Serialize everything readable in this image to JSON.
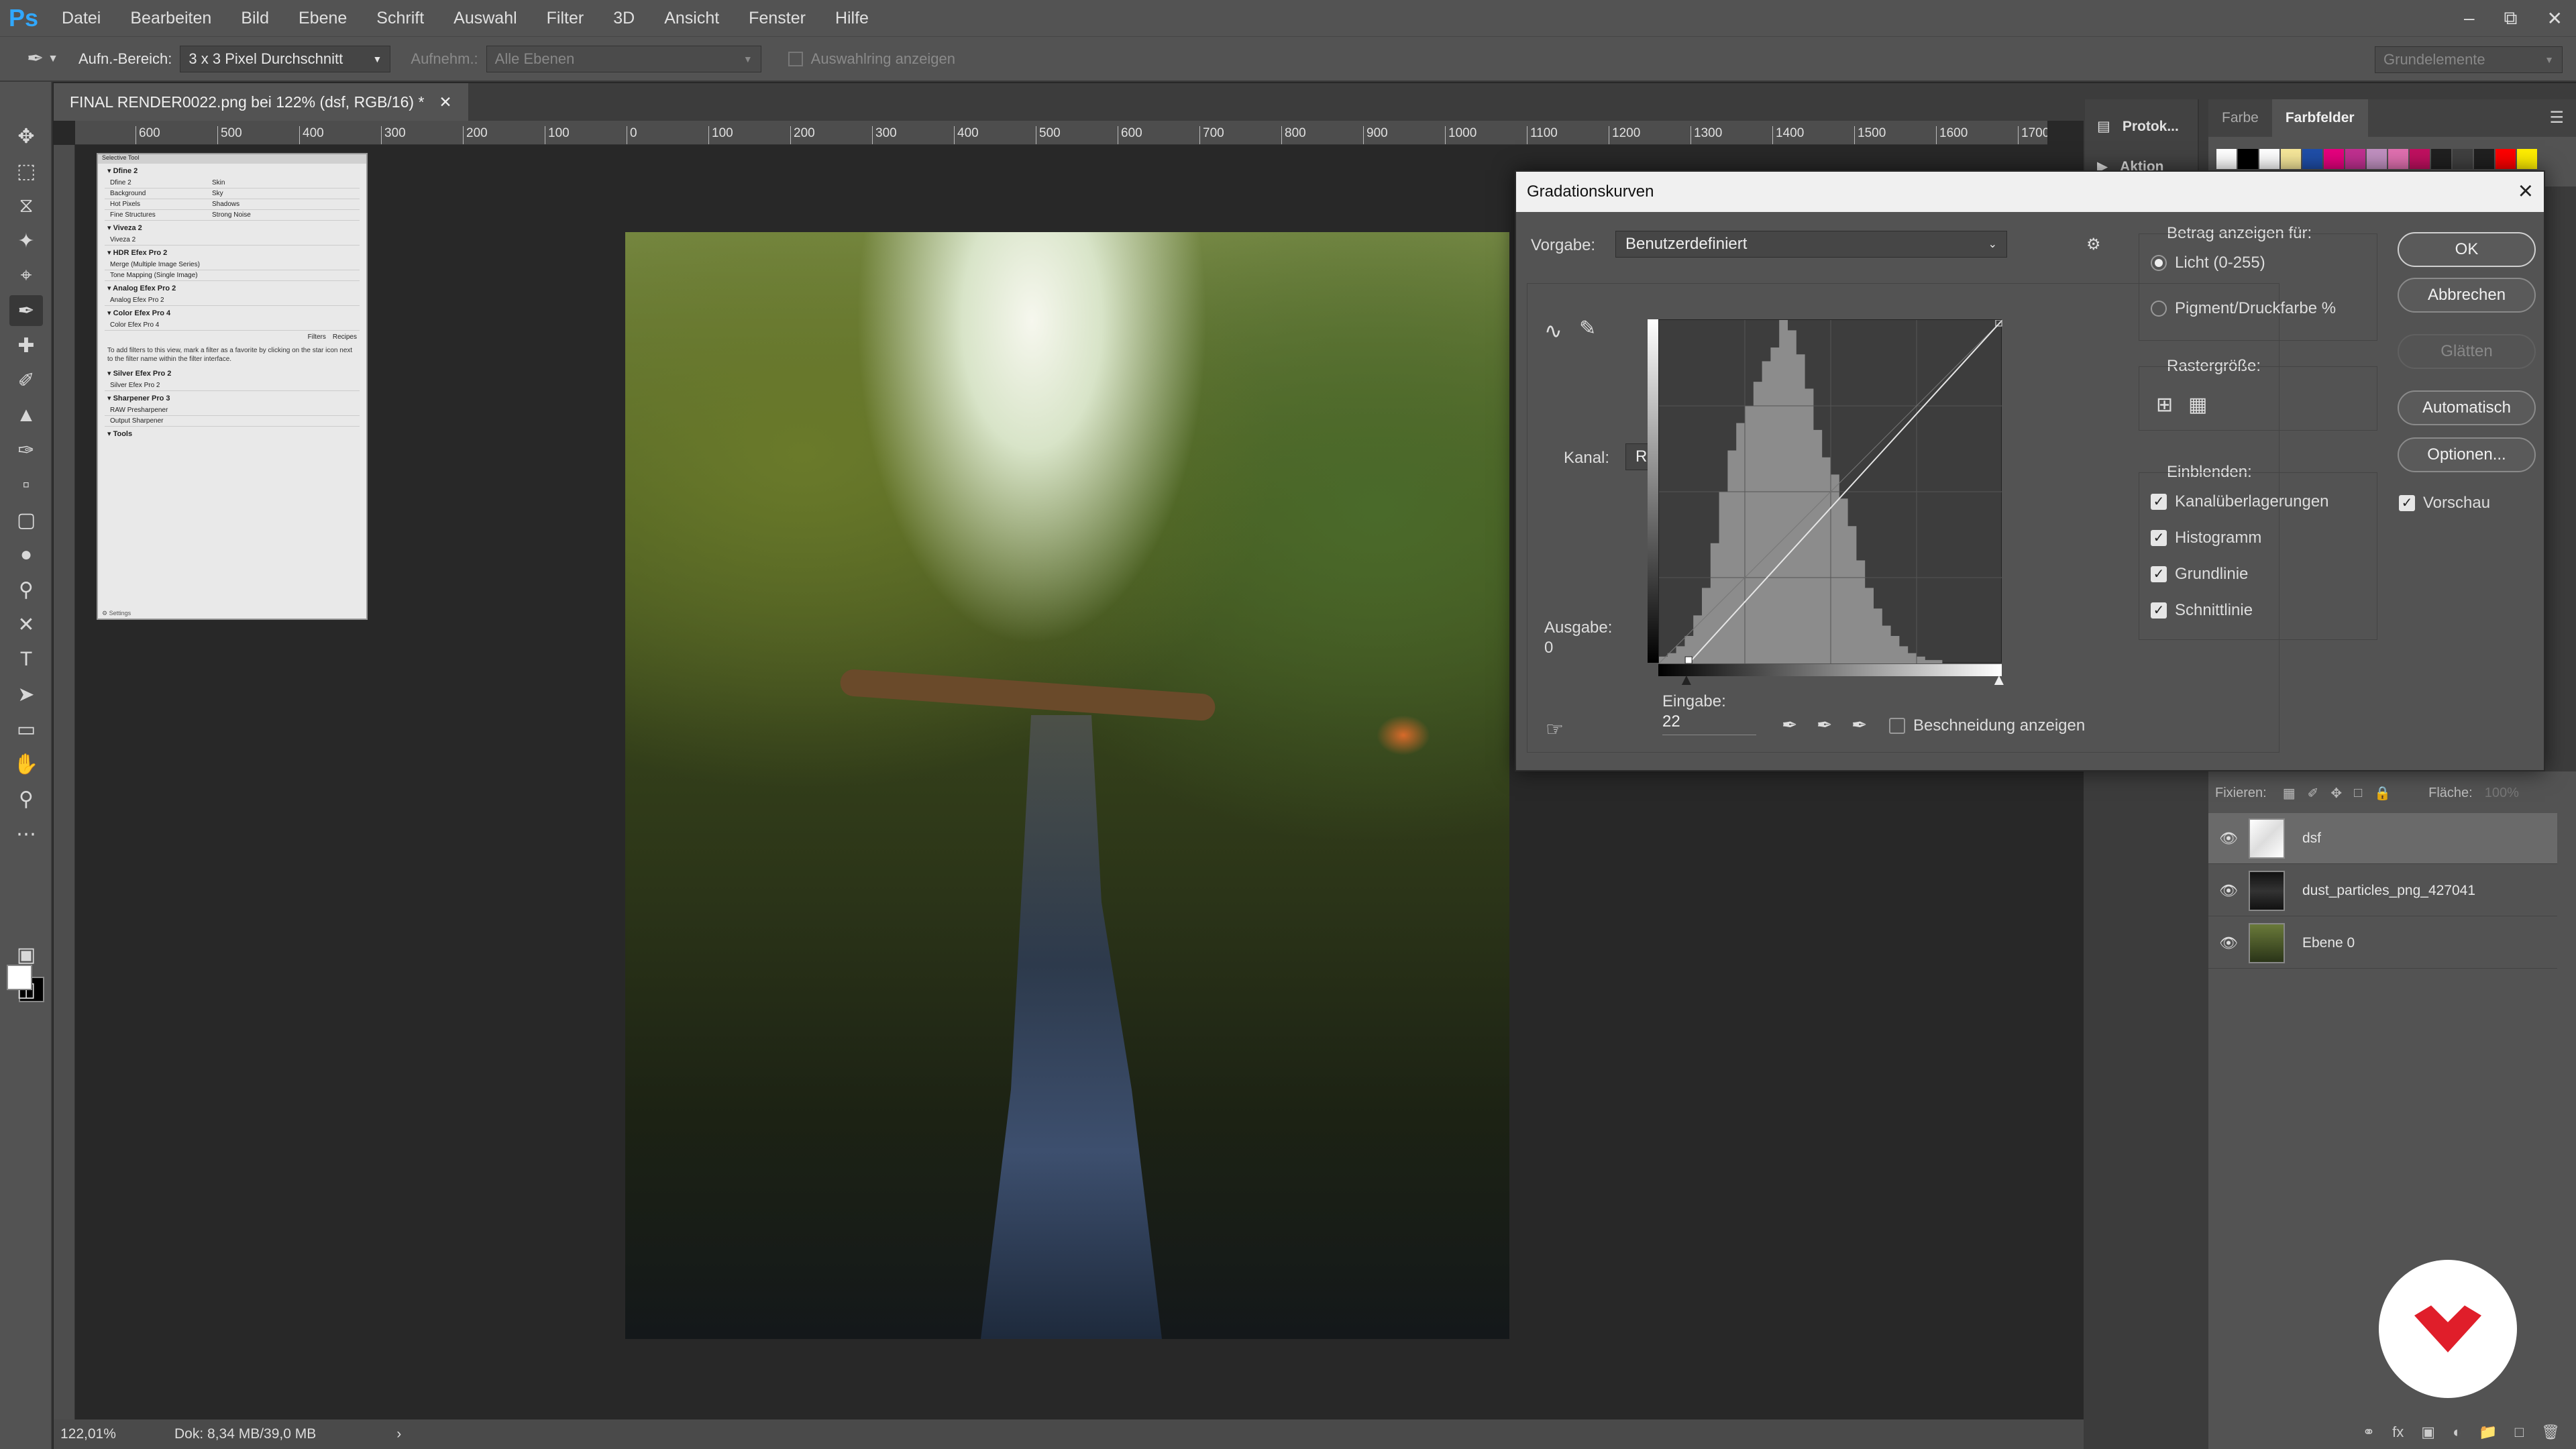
{
  "app": {
    "logo": "Ps"
  },
  "menu": [
    "Datei",
    "Bearbeiten",
    "Bild",
    "Ebene",
    "Schrift",
    "Auswahl",
    "Filter",
    "3D",
    "Ansicht",
    "Fenster",
    "Hilfe"
  ],
  "options_bar": {
    "sample_size_label": "Aufn.-Bereich:",
    "sample_size_value": "3 x 3 Pixel Durchschnitt",
    "sample_label": "Aufnehm.:",
    "sample_value": "Alle Ebenen",
    "show_ring_label": "Auswahlring anzeigen",
    "workspace": "Grundelemente"
  },
  "document": {
    "tab_title": "FINAL RENDER0022.png bei 122% (dsf, RGB/16) *",
    "ruler_ticks": [
      "600",
      "500",
      "400",
      "300",
      "200",
      "100",
      "0",
      "100",
      "200",
      "300",
      "400",
      "500",
      "600",
      "700",
      "800",
      "900",
      "1000",
      "1100",
      "1200",
      "1300",
      "1400",
      "1500",
      "1600",
      "1700"
    ],
    "zoom": "122,01%",
    "doc_size": "Dok: 8,34 MB/39,0 MB"
  },
  "plugin_panel": {
    "title": "Selective Tool",
    "sections": [
      {
        "name": "Dfine 2",
        "rows": [
          [
            "Dfine 2",
            "Skin"
          ],
          [
            "Background",
            "Sky"
          ],
          [
            "Hot Pixels",
            "Shadows"
          ],
          [
            "Fine Structures",
            "Strong Noise"
          ]
        ]
      },
      {
        "name": "Viveza 2",
        "rows": [
          [
            "Viveza 2",
            ""
          ]
        ]
      },
      {
        "name": "HDR Efex Pro 2",
        "rows": [
          [
            "Merge (Multiple Image Series)",
            ""
          ],
          [
            "Tone Mapping (Single Image)",
            ""
          ]
        ]
      },
      {
        "name": "Analog Efex Pro 2",
        "rows": [
          [
            "Analog Efex Pro 2",
            ""
          ]
        ]
      },
      {
        "name": "Color Efex Pro 4",
        "rows": [
          [
            "Color Efex Pro 4",
            ""
          ]
        ]
      }
    ],
    "tabs": [
      "Filters",
      "Recipes"
    ],
    "note": "To add filters to this view, mark a filter as a favorite by clicking on the star icon next to the filter name within the filter interface.",
    "sections2": [
      {
        "name": "Silver Efex Pro 2",
        "rows": [
          [
            "Silver Efex Pro 2",
            ""
          ]
        ]
      },
      {
        "name": "Sharpener Pro 3",
        "rows": [
          [
            "RAW Presharpener",
            ""
          ],
          [
            "Output Sharpener",
            ""
          ]
        ]
      },
      {
        "name": "Tools",
        "rows": []
      }
    ],
    "footer": "Settings"
  },
  "mini_panel": {
    "items": [
      "Protok...",
      "Aktion"
    ]
  },
  "color_panel": {
    "tabs": [
      "Farbe",
      "Farbfelder"
    ],
    "swatches": [
      "#ffffff",
      "#000000",
      "#ffffff",
      "#f6e79a",
      "#1f4ea8",
      "#e6007e",
      "#c03090",
      "#c090c0",
      "#e070b0",
      "#c01060",
      "#202020",
      "#404040",
      "#202020",
      "#ff0000",
      "#ffee00"
    ]
  },
  "layers_panel": {
    "fix_label": "Fixieren:",
    "fill_label": "Fläche:",
    "fill_value": "100%",
    "layers": [
      {
        "name": "dsf",
        "selected": true
      },
      {
        "name": "dust_particles_png_427041",
        "selected": false
      },
      {
        "name": "Ebene 0",
        "selected": false
      }
    ]
  },
  "curves": {
    "title": "Gradationskurven",
    "preset_label": "Vorgabe:",
    "preset_value": "Benutzerdefiniert",
    "channel_label": "Kanal:",
    "channel_value": "RGB",
    "output_label": "Ausgabe:",
    "output_value": "0",
    "input_label": "Eingabe:",
    "input_value": "22",
    "clipping_label": "Beschneidung anzeigen",
    "show_amount_label": "Betrag anzeigen für:",
    "light_label": "Licht (0-255)",
    "pigment_label": "Pigment/Druckfarbe %",
    "grid_size_label": "Rastergröße:",
    "show_label": "Einblenden:",
    "show_options": [
      "Kanalüberlagerungen",
      "Histogramm",
      "Grundlinie",
      "Schnittlinie"
    ],
    "buttons": {
      "ok": "OK",
      "cancel": "Abbrechen",
      "smooth": "Glätten",
      "auto": "Automatisch",
      "options": "Optionen..."
    },
    "preview_label": "Vorschau",
    "histogram": [
      2,
      3,
      5,
      8,
      14,
      22,
      35,
      50,
      62,
      70,
      75,
      82,
      88,
      92,
      100,
      97,
      90,
      80,
      68,
      60,
      55,
      48,
      40,
      30,
      22,
      16,
      11,
      8,
      5,
      3,
      2,
      1,
      1,
      0,
      0,
      0,
      0,
      0,
      0,
      0
    ]
  }
}
